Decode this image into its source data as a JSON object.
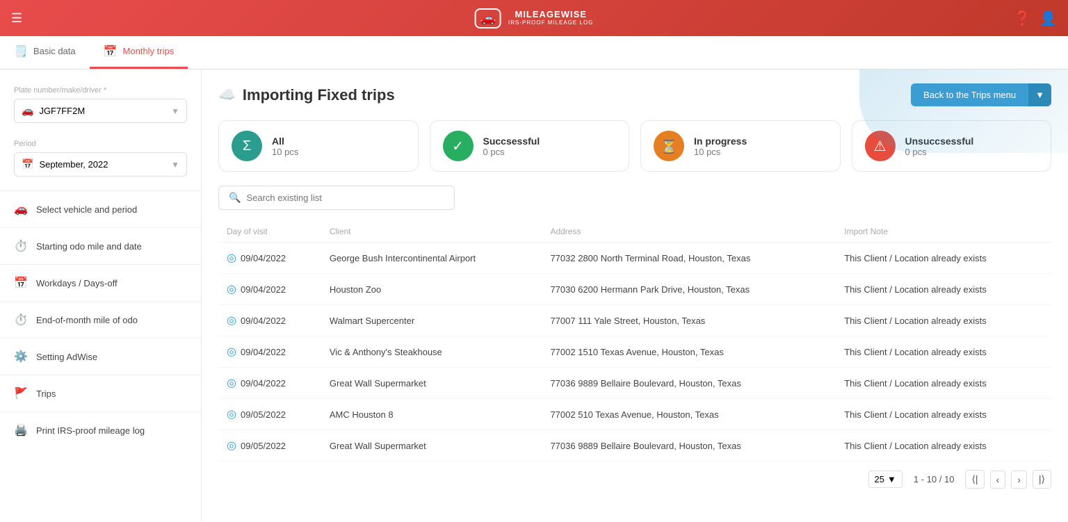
{
  "app": {
    "brand": "MILEAGEWISE",
    "tagline": "IRS-PROOF MILEAGE LOG"
  },
  "tabs": [
    {
      "id": "basic-data",
      "label": "Basic data",
      "icon": "🗒️",
      "active": false
    },
    {
      "id": "monthly-trips",
      "label": "Monthly trips",
      "icon": "📅",
      "active": true
    }
  ],
  "sidebar": {
    "vehicle_label": "Plate number/make/driver *",
    "vehicle_value": "JGF7FF2M",
    "period_label": "Period",
    "period_value": "September, 2022",
    "menu_items": [
      {
        "id": "select-vehicle",
        "label": "Select vehicle and period",
        "icon": "🚗"
      },
      {
        "id": "starting-odo",
        "label": "Starting odo mile and date",
        "icon": "⏱️"
      },
      {
        "id": "workdays",
        "label": "Workdays / Days-off",
        "icon": "📅"
      },
      {
        "id": "end-odo",
        "label": "End-of-month mile of odo",
        "icon": "⏱️"
      },
      {
        "id": "adwise",
        "label": "Setting AdWise",
        "icon": "⚙️"
      },
      {
        "id": "trips",
        "label": "Trips",
        "icon": "🚩"
      },
      {
        "id": "print-log",
        "label": "Print IRS-proof mileage log",
        "icon": "🖨️"
      }
    ]
  },
  "page": {
    "title": "Importing Fixed trips",
    "back_btn": "Back to the Trips menu"
  },
  "status_cards": [
    {
      "id": "all",
      "label": "All",
      "count": "10 pcs",
      "icon_type": "sigma",
      "color": "teal"
    },
    {
      "id": "successful",
      "label": "Succsessful",
      "count": "0 pcs",
      "icon_type": "check",
      "color": "green"
    },
    {
      "id": "in-progress",
      "label": "In progress",
      "count": "10 pcs",
      "icon_type": "hourglass",
      "color": "orange"
    },
    {
      "id": "unsuccessful",
      "label": "Unsuccsessful",
      "count": "0 pcs",
      "icon_type": "warning",
      "color": "red"
    }
  ],
  "search": {
    "placeholder": "Search existing list"
  },
  "table": {
    "headers": [
      "Day of visit",
      "Client",
      "Address",
      "Import Note"
    ],
    "rows": [
      {
        "date": "09/04/2022",
        "client": "George Bush Intercontinental Airport",
        "address": "77032 2800 North Terminal Road, Houston, Texas",
        "note": "This Client / Location already exists"
      },
      {
        "date": "09/04/2022",
        "client": "Houston Zoo",
        "address": "77030 6200 Hermann Park Drive, Houston, Texas",
        "note": "This Client / Location already exists"
      },
      {
        "date": "09/04/2022",
        "client": "Walmart Supercenter",
        "address": "77007 111 Yale Street, Houston, Texas",
        "note": "This Client / Location already exists"
      },
      {
        "date": "09/04/2022",
        "client": "Vic & Anthony's Steakhouse",
        "address": "77002 1510 Texas Avenue, Houston, Texas",
        "note": "This Client / Location already exists"
      },
      {
        "date": "09/04/2022",
        "client": "Great Wall Supermarket",
        "address": "77036 9889 Bellaire Boulevard, Houston, Texas",
        "note": "This Client / Location already exists"
      },
      {
        "date": "09/05/2022",
        "client": "AMC Houston 8",
        "address": "77002 510 Texas Avenue, Houston, Texas",
        "note": "This Client / Location already exists"
      },
      {
        "date": "09/05/2022",
        "client": "Great Wall Supermarket",
        "address": "77036 9889 Bellaire Boulevard, Houston, Texas",
        "note": "This Client / Location already exists"
      }
    ]
  },
  "pagination": {
    "per_page": "25",
    "page_info": "1 - 10 / 10"
  }
}
